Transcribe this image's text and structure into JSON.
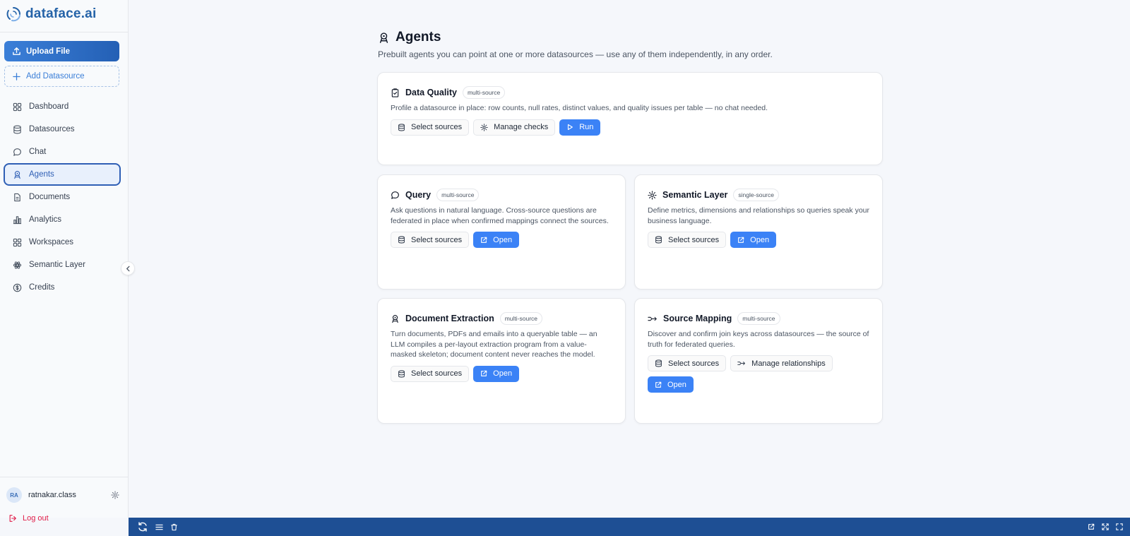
{
  "brand": {
    "name": "dataface.ai",
    "accent": "#2563a8",
    "primary": "#3b82f6"
  },
  "sidebar": {
    "upload_label": "Upload File",
    "add_label": "Add Datasource",
    "items": [
      {
        "label": "Dashboard",
        "icon": "dashboard-icon"
      },
      {
        "label": "Datasources",
        "icon": "database-icon"
      },
      {
        "label": "Chat",
        "icon": "chat-icon"
      },
      {
        "label": "Agents",
        "icon": "agent-icon",
        "active": true
      },
      {
        "label": "Documents",
        "icon": "document-icon"
      },
      {
        "label": "Analytics",
        "icon": "analytics-icon"
      },
      {
        "label": "Workspaces",
        "icon": "workspaces-icon"
      },
      {
        "label": "Semantic Layer",
        "icon": "semantic-layer-icon"
      },
      {
        "label": "Credits",
        "icon": "credits-icon"
      }
    ],
    "user": {
      "initials": "RA",
      "name": "ratnakar.class"
    },
    "logout_label": "Log out"
  },
  "main": {
    "title": "Agents",
    "subtitle": "Prebuilt agents you can point at one or more datasources — use any of them independently, in any order.",
    "cards": [
      {
        "title": "Data Quality",
        "badge": "multi-source",
        "description": "Profile a datasource in place: row counts, null rates, distinct values, and quality issues per table — no chat needed.",
        "buttons": [
          "Select sources",
          "Manage checks",
          "Run"
        ]
      },
      {
        "title": "Query",
        "badge": "multi-source",
        "description": "Ask questions in natural language. Cross-source questions are federated in place when confirmed mappings connect the sources.",
        "buttons": [
          "Select sources",
          "Open"
        ]
      },
      {
        "title": "Semantic Layer",
        "badge": "single-source",
        "description": "Define metrics, dimensions and relationships so queries speak your business language.",
        "buttons": [
          "Select sources",
          "Open"
        ]
      },
      {
        "title": "Document Extraction",
        "badge": "multi-source",
        "description": "Turn documents, PDFs and emails into a queryable table — an LLM compiles a per-layout extraction program from a value-masked skeleton; document content never reaches the model.",
        "buttons": [
          "Select sources",
          "Open"
        ]
      },
      {
        "title": "Source Mapping",
        "badge": "multi-source",
        "description": "Discover and confirm join keys across datasources — the source of truth for federated queries.",
        "buttons": [
          "Select sources",
          "Manage relationships",
          "Open"
        ]
      }
    ]
  }
}
